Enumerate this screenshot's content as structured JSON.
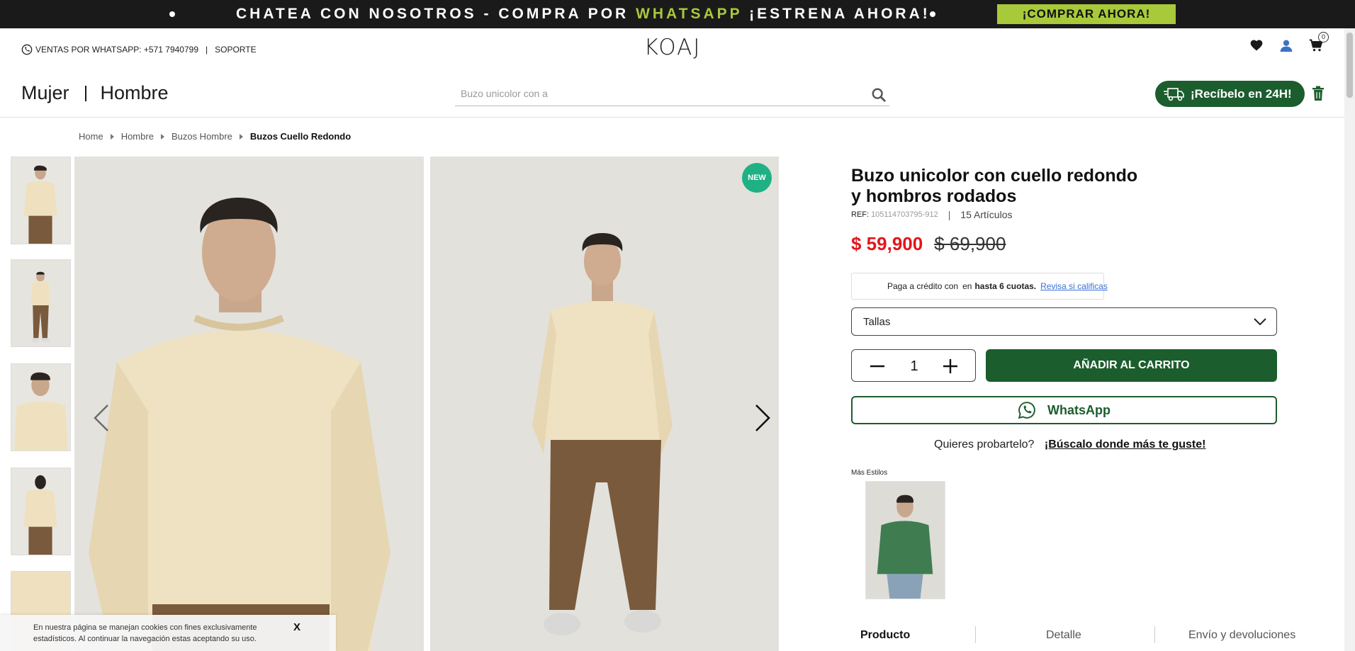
{
  "promo": {
    "text_part1": "CHATEA CON NOSOTROS - COMPRA POR ",
    "text_highlight": "WHATSAPP",
    "text_part2": " ¡ESTRENA AHORA!",
    "cta_label": "¡COMPRAR AHORA!"
  },
  "utility": {
    "whatsapp_label": "VENTAS POR WHATSAPP: +571 7940799",
    "separator": "|",
    "support_label": "SOPORTE"
  },
  "logo": "KOAJ",
  "cart": {
    "count": "0"
  },
  "nav": {
    "women": "Mujer",
    "men": "Hombre"
  },
  "search": {
    "placeholder": "Buzo unicolor con a"
  },
  "express_label": "¡Recíbelo en 24H!",
  "breadcrumb": [
    "Home",
    "Hombre",
    "Buzos Hombre",
    "Buzos Cuello Redondo"
  ],
  "badge_new": "NEW",
  "product": {
    "title": "Buzo unicolor con cuello redondo y hombros rodados",
    "ref_label": "REF:",
    "ref_value": "105114703795-912",
    "stock": "15 Artículos",
    "price_now": "$ 59,900",
    "price_old": "$ 69,900",
    "credit_text_1": "Paga a crédito con",
    "credit_text_2": "en",
    "credit_bold": "hasta 6 cuotas.",
    "credit_link": "Revisa si calificas",
    "sizes_label": "Tallas",
    "quantity": "1",
    "add_to_cart": "AÑADIR AL CARRITO",
    "whatsapp_button": "WhatsApp",
    "tryon_question": "Quieres probartelo?",
    "tryon_link": "¡Búscalo donde más te guste!",
    "more_styles": "Más Estilos"
  },
  "tabs": [
    "Producto",
    "Detalle",
    "Envío y devoluciones"
  ],
  "cookie": {
    "message": "En nuestra página se manejan cookies con fines exclusivamente estadísticos. Al continuar la navegación estas aceptando su uso.",
    "close": "X"
  },
  "colors": {
    "brand_green": "#1c5d2e",
    "promo_highlight": "#a8c93a",
    "price_red": "#e3151b",
    "new_badge": "#1fb184"
  }
}
